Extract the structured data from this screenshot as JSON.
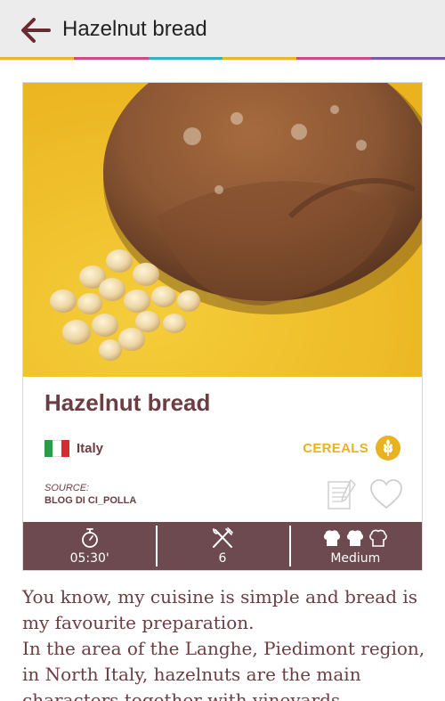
{
  "appbar": {
    "title": "Hazelnut bread",
    "back_icon": "arrow-left-icon"
  },
  "colors": {
    "appbar_bg": "#ececec",
    "rainbow": [
      "#e6b82a",
      "#c94d84",
      "#3ab0c8",
      "#e6b82a",
      "#c94d84",
      "#7a5aa8"
    ],
    "brand": "#6b3e43",
    "stat_bar": "#6d4a4f",
    "category": "#e8b220"
  },
  "recipe": {
    "title": "Hazelnut bread",
    "country": "Italy",
    "flag_icon": "italy-flag-icon",
    "category": "CEREALS",
    "category_icon": "wheat-icon",
    "source_label": "SOURCE:",
    "source_value": "BLOG DI CI_POLLA"
  },
  "stats": {
    "time": "05:30'",
    "servings": "6",
    "difficulty": "Medium",
    "difficulty_level": 2,
    "difficulty_max": 3
  },
  "description": "You know, my cuisine is simple and bread is my favourite preparation.\nIn the area of the Langhe, Piedimont region, in North Italy, hazelnuts are the main characters together with vineyards"
}
